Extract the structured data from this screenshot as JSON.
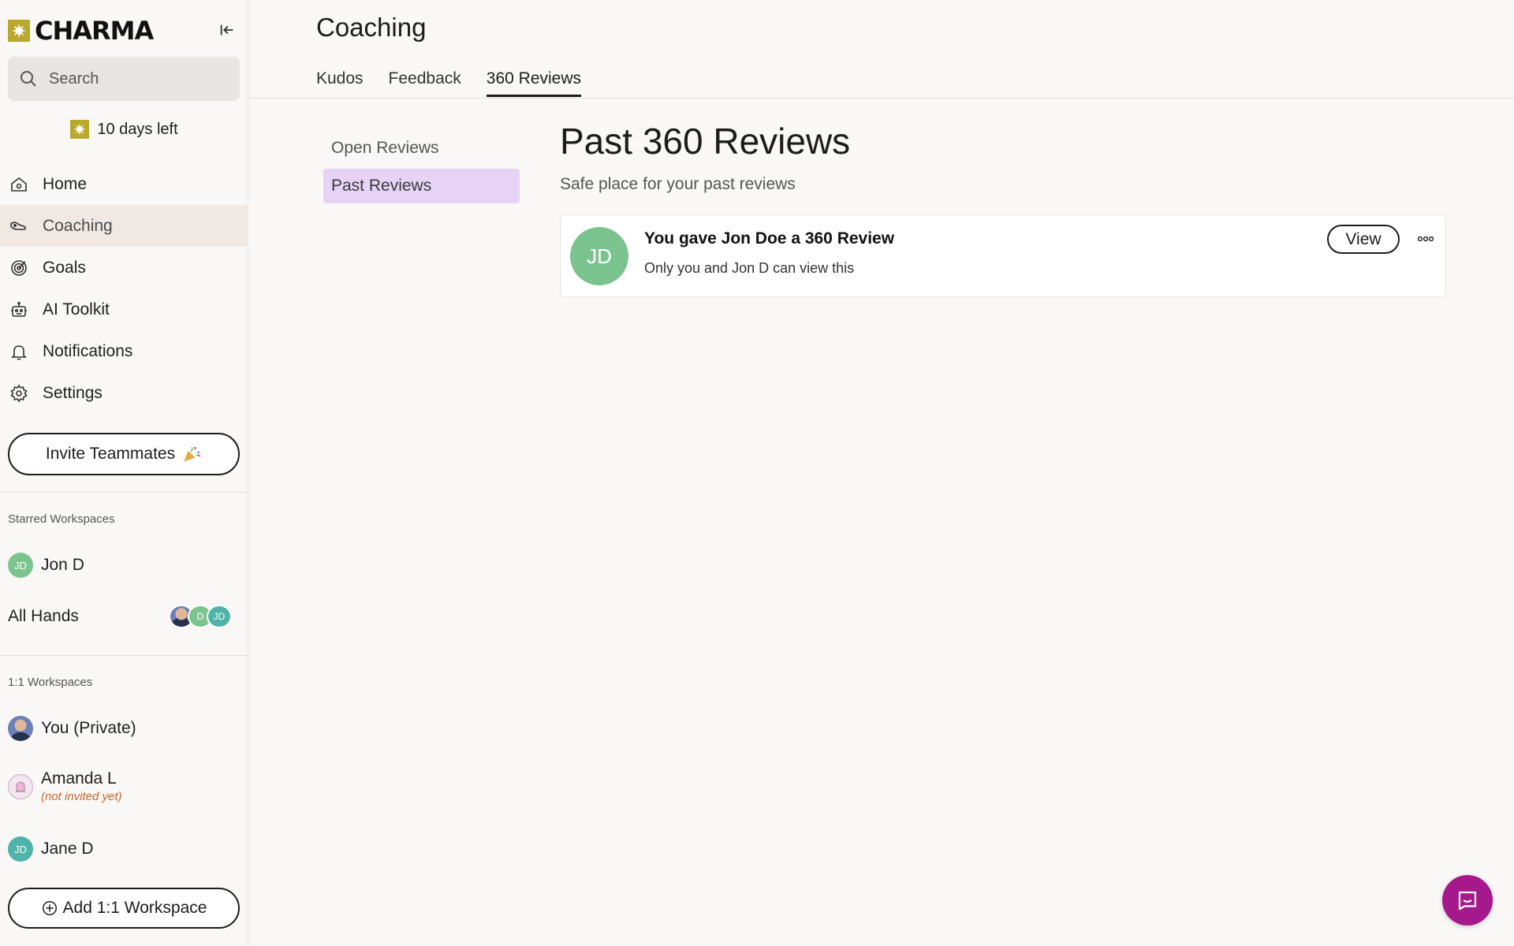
{
  "app": {
    "name": "CHARMA",
    "brand_color": "#b8a92c",
    "accent_color": "#a6198c"
  },
  "sidebar": {
    "search_placeholder": "Search",
    "trial_text": "10 days left",
    "nav": [
      {
        "label": "Home",
        "icon": "home-icon"
      },
      {
        "label": "Coaching",
        "icon": "coaching-icon",
        "active": true
      },
      {
        "label": "Goals",
        "icon": "target-icon"
      },
      {
        "label": "AI Toolkit",
        "icon": "robot-icon"
      },
      {
        "label": "Notifications",
        "icon": "bell-icon"
      },
      {
        "label": "Settings",
        "icon": "gear-icon"
      }
    ],
    "invite_label": "Invite Teammates",
    "starred_label": "Starred Workspaces",
    "starred": [
      {
        "label": "Jon D",
        "initials": "JD"
      },
      {
        "label": "All Hands",
        "avatars": [
          "",
          "D",
          "JD"
        ]
      }
    ],
    "one_on_one_label": "1:1 Workspaces",
    "one_on_one": [
      {
        "label": "You (Private)"
      },
      {
        "label": "Amanda L",
        "note": "(not invited yet)"
      },
      {
        "label": "Jane D",
        "initials": "JD"
      }
    ],
    "add_label": "Add 1:1 Workspace"
  },
  "main": {
    "page_title": "Coaching",
    "tabs": [
      {
        "label": "Kudos"
      },
      {
        "label": "Feedback"
      },
      {
        "label": "360 Reviews",
        "active": true
      }
    ],
    "subnav": [
      {
        "label": "Open Reviews"
      },
      {
        "label": "Past Reviews",
        "active": true
      }
    ],
    "heading": "Past 360 Reviews",
    "subheading": "Safe place for your past reviews",
    "reviews": [
      {
        "initials": "JD",
        "title": "You gave Jon Doe a 360 Review",
        "subtitle": "Only you and Jon D can view this",
        "view_label": "View"
      }
    ]
  }
}
